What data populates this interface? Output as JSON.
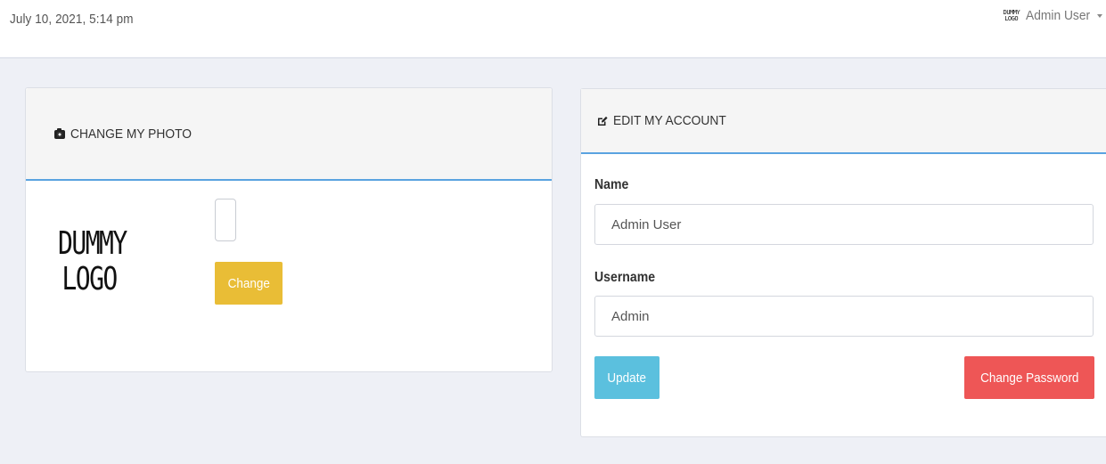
{
  "header": {
    "datetime": "July 10, 2021, 5:14 pm",
    "user_avatar_line1": "DUMMY",
    "user_avatar_line2": "LOGO",
    "user_name": "Admin User"
  },
  "photo_panel": {
    "title": "CHANGE MY PHOTO",
    "title_icon": "camera-icon",
    "logo_line1": "DUMMY",
    "logo_line2": "LOGO",
    "change_button": "Change"
  },
  "account_panel": {
    "title": "EDIT MY ACCOUNT",
    "title_icon": "edit-icon",
    "name_label": "Name",
    "name_value": "Admin User",
    "username_label": "Username",
    "username_value": "Admin",
    "update_button": "Update",
    "change_password_button": "Change Password"
  },
  "colors": {
    "accent_border": "#5aa3e0",
    "change_button": "#e9bd36",
    "update_button": "#5bc0de",
    "change_password_button": "#ee5656"
  }
}
